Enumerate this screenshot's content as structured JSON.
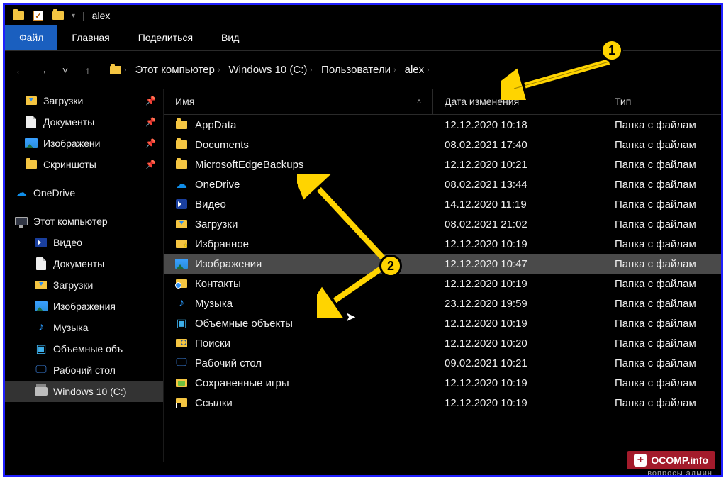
{
  "title": "alex",
  "tabs": {
    "file": "Файл",
    "home": "Главная",
    "share": "Поделиться",
    "view": "Вид"
  },
  "breadcrumb": [
    {
      "label": "Этот компьютер"
    },
    {
      "label": "Windows 10 (C:)"
    },
    {
      "label": "Пользователи"
    },
    {
      "label": "alex"
    }
  ],
  "columns": {
    "name": "Имя",
    "modified": "Дата изменения",
    "type": "Тип"
  },
  "sidebar": {
    "quick": [
      {
        "label": "Загрузки",
        "icon": "downloads",
        "pinned": true
      },
      {
        "label": "Документы",
        "icon": "document",
        "pinned": true
      },
      {
        "label": "Изображени",
        "icon": "pictures",
        "pinned": true
      },
      {
        "label": "Скриншоты",
        "icon": "folder",
        "pinned": true
      }
    ],
    "onedrive": {
      "label": "OneDrive"
    },
    "thispc": {
      "label": "Этот компьютер"
    },
    "pc_items": [
      {
        "label": "Видео",
        "icon": "video"
      },
      {
        "label": "Документы",
        "icon": "document"
      },
      {
        "label": "Загрузки",
        "icon": "downloads"
      },
      {
        "label": "Изображения",
        "icon": "pictures"
      },
      {
        "label": "Музыка",
        "icon": "music"
      },
      {
        "label": "Объемные объ",
        "icon": "cube"
      },
      {
        "label": "Рабочий стол",
        "icon": "desktop"
      },
      {
        "label": "Windows 10 (C:)",
        "icon": "drive",
        "selected": true
      }
    ]
  },
  "rows": [
    {
      "name": "AppData",
      "icon": "folder",
      "modified": "12.12.2020 10:18",
      "type": "Папка с файлам"
    },
    {
      "name": "Documents",
      "icon": "folder",
      "modified": "08.02.2021 17:40",
      "type": "Папка с файлам"
    },
    {
      "name": "MicrosoftEdgeBackups",
      "icon": "folder",
      "modified": "12.12.2020 10:21",
      "type": "Папка с файлам"
    },
    {
      "name": "OneDrive",
      "icon": "onedrive",
      "modified": "08.02.2021 13:44",
      "type": "Папка с файлам"
    },
    {
      "name": "Видео",
      "icon": "video",
      "modified": "14.12.2020 11:19",
      "type": "Папка с файлам"
    },
    {
      "name": "Загрузки",
      "icon": "downloads",
      "modified": "08.02.2021 21:02",
      "type": "Папка с файлам"
    },
    {
      "name": "Избранное",
      "icon": "favorites",
      "modified": "12.12.2020 10:19",
      "type": "Папка с файлам"
    },
    {
      "name": "Изображения",
      "icon": "pictures",
      "modified": "12.12.2020 10:47",
      "type": "Папка с файлам",
      "selected": true
    },
    {
      "name": "Контакты",
      "icon": "contacts",
      "modified": "12.12.2020 10:19",
      "type": "Папка с файлам"
    },
    {
      "name": "Музыка",
      "icon": "music",
      "modified": "23.12.2020 19:59",
      "type": "Папка с файлам"
    },
    {
      "name": "Объемные объекты",
      "icon": "cube",
      "modified": "12.12.2020 10:19",
      "type": "Папка с файлам"
    },
    {
      "name": "Поиски",
      "icon": "search",
      "modified": "12.12.2020 10:20",
      "type": "Папка с файлам"
    },
    {
      "name": "Рабочий стол",
      "icon": "desktop",
      "modified": "09.02.2021 10:21",
      "type": "Папка с файлам"
    },
    {
      "name": "Сохраненные игры",
      "icon": "saved",
      "modified": "12.12.2020 10:19",
      "type": "Папка с файлам"
    },
    {
      "name": "Ссылки",
      "icon": "links",
      "modified": "12.12.2020 10:19",
      "type": "Папка с файлам"
    }
  ],
  "callouts": {
    "one": "1",
    "two": "2"
  },
  "watermark": {
    "brand": "OCOMP.info",
    "sub": "вопросы админ"
  }
}
